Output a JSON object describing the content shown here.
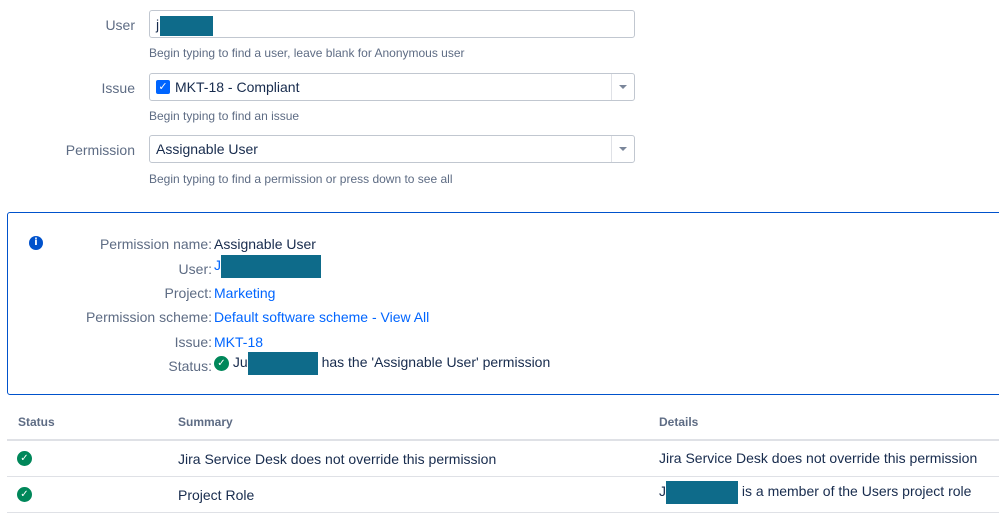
{
  "form": {
    "user": {
      "label": "User",
      "value": "j",
      "help": "Begin typing to find a user, leave blank for Anonymous user"
    },
    "issue": {
      "label": "Issue",
      "value": "MKT-18 - Compliant",
      "help": "Begin typing to find an issue"
    },
    "permission": {
      "label": "Permission",
      "value": "Assignable User",
      "help": "Begin typing to find a permission or press down to see all"
    }
  },
  "result": {
    "info_icon": "info-icon",
    "rows": [
      {
        "label": "Permission name:",
        "value": "Assignable User"
      },
      {
        "label": "User:",
        "value": "J"
      },
      {
        "label": "Project:",
        "value": "Marketing"
      },
      {
        "label": "Permission scheme:",
        "value": "Default software scheme - View All"
      },
      {
        "label": "Issue:",
        "value": "MKT-18"
      },
      {
        "label": "Status:",
        "value_prefix": "Ju",
        "value_suffix": "has the 'Assignable User' permission"
      }
    ]
  },
  "table": {
    "headers": [
      "Status",
      "Summary",
      "Details"
    ],
    "rows": [
      {
        "status_icon": "check-circle-icon",
        "summary": "Jira Service Desk does not override this permission",
        "details": "Jira Service Desk does not override this permission"
      },
      {
        "status_icon": "check-circle-icon",
        "summary": "Project Role",
        "details_prefix": "J",
        "details_suffix": "is a member of the Users project role"
      }
    ]
  },
  "colors": {
    "accent": "#0052cc",
    "link": "#0065ff",
    "success": "#00875a",
    "redaction": "#0e6b8a"
  }
}
